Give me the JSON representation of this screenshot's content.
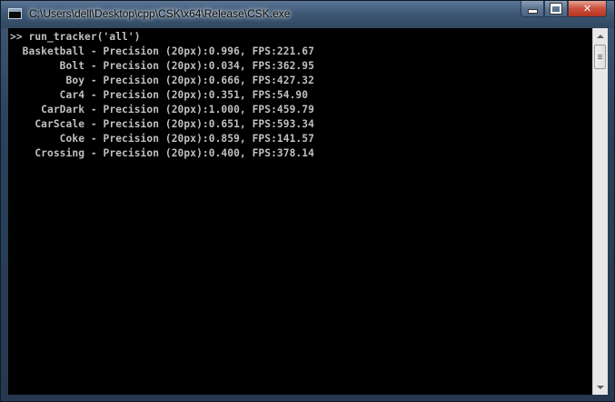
{
  "window": {
    "title": "C:\\Users\\dell\\Desktop\\cpp\\CSK\\x64\\Release\\CSK.exe",
    "icon": "console-app-icon"
  },
  "caption_buttons": {
    "minimize_icon": "minimize-icon",
    "maximize_icon": "maximize-icon",
    "close_glyph": "✕"
  },
  "console": {
    "lines": [
      ">> run_tracker('all')",
      "  Basketball - Precision (20px):0.996, FPS:221.67",
      "        Bolt - Precision (20px):0.034, FPS:362.95",
      "         Boy - Precision (20px):0.666, FPS:427.32",
      "        Car4 - Precision (20px):0.351, FPS:54.90",
      "     CarDark - Precision (20px):1.000, FPS:459.79",
      "    CarScale - Precision (20px):0.651, FPS:593.34",
      "        Coke - Precision (20px):0.859, FPS:141.57",
      "    Crossing - Precision (20px):0.400, FPS:378.14"
    ],
    "colors": {
      "background": "#000000",
      "text": "#c0c0c0"
    }
  },
  "scrollbar": {
    "up_icon": "scroll-up-arrow-icon",
    "down_icon": "scroll-down-arrow-icon"
  }
}
